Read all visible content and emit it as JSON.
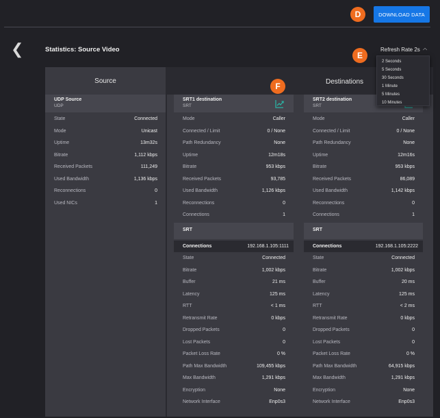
{
  "header": {
    "download_label": "DOWNLOAD DATA"
  },
  "callouts": {
    "d": "D",
    "e": "E",
    "f": "F"
  },
  "page": {
    "title": "Statistics:  Source Video"
  },
  "refresh": {
    "label": "Refresh Rate 2s",
    "options": [
      "2 Seconds",
      "5 Seconds",
      "30 Seconds",
      "1 Minute",
      "5 Minutes",
      "10 Minutes"
    ]
  },
  "source": {
    "header": "Source",
    "title": "UDP Source",
    "subtitle": "UDP",
    "rows": [
      {
        "k": "State",
        "v": "Connected"
      },
      {
        "k": "Mode",
        "v": "Unicast"
      },
      {
        "k": "Uptime",
        "v": "13m32s"
      },
      {
        "k": "Bitrate",
        "v": "1,112 kbps"
      },
      {
        "k": "Received Packets",
        "v": "111,249"
      },
      {
        "k": "Used Bandwidth",
        "v": "1,136 kbps"
      },
      {
        "k": "Reconnections",
        "v": "0"
      },
      {
        "k": "Used NICs",
        "v": "1"
      }
    ]
  },
  "destinations": {
    "header": "Destinations",
    "cards": [
      {
        "title": "SRT1 destination",
        "subtitle": "SRT",
        "rows": [
          {
            "k": "Mode",
            "v": "Caller"
          },
          {
            "k": "Connected / Limit",
            "v": "0 / None"
          },
          {
            "k": "Path Redundancy",
            "v": "None"
          },
          {
            "k": "Uptime",
            "v": "12m18s"
          },
          {
            "k": "Bitrate",
            "v": "953 kbps"
          },
          {
            "k": "Received Packets",
            "v": "93,785"
          },
          {
            "k": "Used Bandwidth",
            "v": "1,126 kbps"
          },
          {
            "k": "Reconnections",
            "v": "0"
          },
          {
            "k": "Connections",
            "v": "1"
          }
        ],
        "section": "SRT",
        "conn_label": "Connections",
        "conn_value": "192.168.1.105:1111",
        "srt_rows": [
          {
            "k": "State",
            "v": "Connected"
          },
          {
            "k": "Bitrate",
            "v": "1,002 kbps"
          },
          {
            "k": "Buffer",
            "v": "21 ms"
          },
          {
            "k": "Latency",
            "v": "125 ms"
          },
          {
            "k": "RTT",
            "v": "< 1 ms"
          },
          {
            "k": "Retransmit Rate",
            "v": "0 kbps"
          },
          {
            "k": "Dropped Packets",
            "v": "0"
          },
          {
            "k": "Lost Packets",
            "v": "0"
          },
          {
            "k": "Packet Loss Rate",
            "v": "0 %"
          },
          {
            "k": "Path Max Bandwidth",
            "v": "109,455 kbps"
          },
          {
            "k": "Max Bandwidth",
            "v": "1,291 kbps"
          },
          {
            "k": "Encryption",
            "v": "None"
          },
          {
            "k": "Network Interface",
            "v": "Enp0s3"
          }
        ]
      },
      {
        "title": "SRT2 destination",
        "subtitle": "SRT",
        "rows": [
          {
            "k": "Mode",
            "v": "Caller"
          },
          {
            "k": "Connected / Limit",
            "v": "0 / None"
          },
          {
            "k": "Path Redundancy",
            "v": "None"
          },
          {
            "k": "Uptime",
            "v": "12m16s"
          },
          {
            "k": "Bitrate",
            "v": "953 kbps"
          },
          {
            "k": "Received Packets",
            "v": "86,089"
          },
          {
            "k": "Used Bandwidth",
            "v": "1,142 kbps"
          },
          {
            "k": "Reconnections",
            "v": "0"
          },
          {
            "k": "Connections",
            "v": "1"
          }
        ],
        "section": "SRT",
        "conn_label": "Connections",
        "conn_value": "192.168.1.105:2222",
        "srt_rows": [
          {
            "k": "State",
            "v": "Connected"
          },
          {
            "k": "Bitrate",
            "v": "1,002 kbps"
          },
          {
            "k": "Buffer",
            "v": "20 ms"
          },
          {
            "k": "Latency",
            "v": "125 ms"
          },
          {
            "k": "RTT",
            "v": "< 2 ms"
          },
          {
            "k": "Retransmit Rate",
            "v": "0 kbps"
          },
          {
            "k": "Dropped Packets",
            "v": "0"
          },
          {
            "k": "Lost Packets",
            "v": "0"
          },
          {
            "k": "Packet Loss Rate",
            "v": "0 %"
          },
          {
            "k": "Path Max Bandwidth",
            "v": "64,915 kbps"
          },
          {
            "k": "Max Bandwidth",
            "v": "1,291 kbps"
          },
          {
            "k": "Encryption",
            "v": "None"
          },
          {
            "k": "Network Interface",
            "v": "Enp0s3"
          }
        ]
      }
    ]
  },
  "colors": {
    "accent": "#1677e6",
    "callout": "#ef6c1f",
    "chart_icon": "#2bb3a3"
  }
}
